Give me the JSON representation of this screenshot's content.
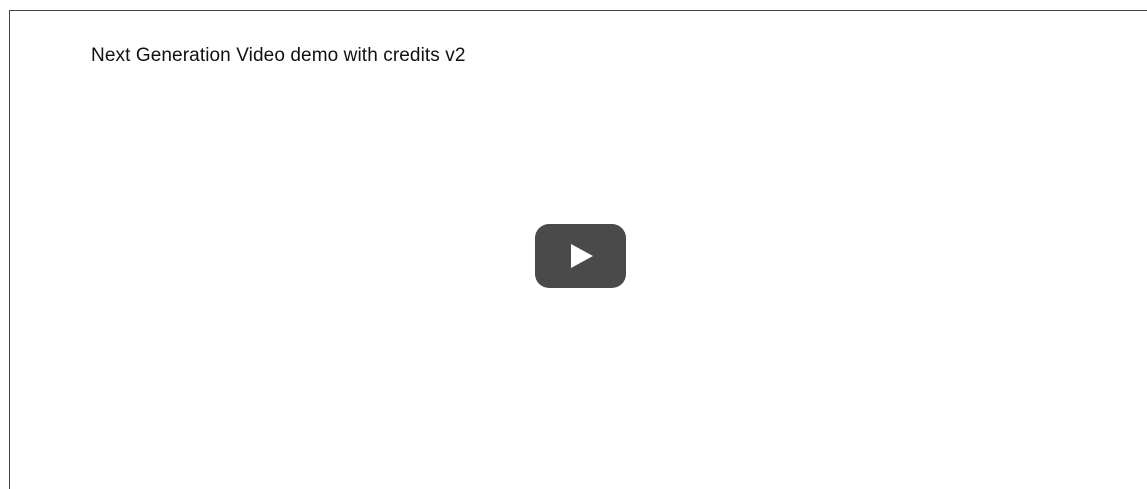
{
  "video": {
    "title": "Next Generation Video demo with credits v2",
    "play_icon": "play-icon",
    "play_button_color": "#4a4a4a",
    "play_icon_color": "#ffffff"
  }
}
